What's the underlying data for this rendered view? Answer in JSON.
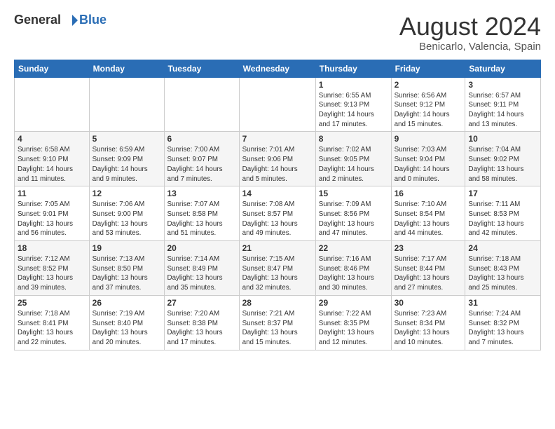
{
  "header": {
    "logo_general": "General",
    "logo_blue": "Blue",
    "title": "August 2024",
    "subtitle": "Benicarlo, Valencia, Spain"
  },
  "weekdays": [
    "Sunday",
    "Monday",
    "Tuesday",
    "Wednesday",
    "Thursday",
    "Friday",
    "Saturday"
  ],
  "weeks": [
    [
      {
        "day": "",
        "info": ""
      },
      {
        "day": "",
        "info": ""
      },
      {
        "day": "",
        "info": ""
      },
      {
        "day": "",
        "info": ""
      },
      {
        "day": "1",
        "info": "Sunrise: 6:55 AM\nSunset: 9:13 PM\nDaylight: 14 hours\nand 17 minutes."
      },
      {
        "day": "2",
        "info": "Sunrise: 6:56 AM\nSunset: 9:12 PM\nDaylight: 14 hours\nand 15 minutes."
      },
      {
        "day": "3",
        "info": "Sunrise: 6:57 AM\nSunset: 9:11 PM\nDaylight: 14 hours\nand 13 minutes."
      }
    ],
    [
      {
        "day": "4",
        "info": "Sunrise: 6:58 AM\nSunset: 9:10 PM\nDaylight: 14 hours\nand 11 minutes."
      },
      {
        "day": "5",
        "info": "Sunrise: 6:59 AM\nSunset: 9:09 PM\nDaylight: 14 hours\nand 9 minutes."
      },
      {
        "day": "6",
        "info": "Sunrise: 7:00 AM\nSunset: 9:07 PM\nDaylight: 14 hours\nand 7 minutes."
      },
      {
        "day": "7",
        "info": "Sunrise: 7:01 AM\nSunset: 9:06 PM\nDaylight: 14 hours\nand 5 minutes."
      },
      {
        "day": "8",
        "info": "Sunrise: 7:02 AM\nSunset: 9:05 PM\nDaylight: 14 hours\nand 2 minutes."
      },
      {
        "day": "9",
        "info": "Sunrise: 7:03 AM\nSunset: 9:04 PM\nDaylight: 14 hours\nand 0 minutes."
      },
      {
        "day": "10",
        "info": "Sunrise: 7:04 AM\nSunset: 9:02 PM\nDaylight: 13 hours\nand 58 minutes."
      }
    ],
    [
      {
        "day": "11",
        "info": "Sunrise: 7:05 AM\nSunset: 9:01 PM\nDaylight: 13 hours\nand 56 minutes."
      },
      {
        "day": "12",
        "info": "Sunrise: 7:06 AM\nSunset: 9:00 PM\nDaylight: 13 hours\nand 53 minutes."
      },
      {
        "day": "13",
        "info": "Sunrise: 7:07 AM\nSunset: 8:58 PM\nDaylight: 13 hours\nand 51 minutes."
      },
      {
        "day": "14",
        "info": "Sunrise: 7:08 AM\nSunset: 8:57 PM\nDaylight: 13 hours\nand 49 minutes."
      },
      {
        "day": "15",
        "info": "Sunrise: 7:09 AM\nSunset: 8:56 PM\nDaylight: 13 hours\nand 47 minutes."
      },
      {
        "day": "16",
        "info": "Sunrise: 7:10 AM\nSunset: 8:54 PM\nDaylight: 13 hours\nand 44 minutes."
      },
      {
        "day": "17",
        "info": "Sunrise: 7:11 AM\nSunset: 8:53 PM\nDaylight: 13 hours\nand 42 minutes."
      }
    ],
    [
      {
        "day": "18",
        "info": "Sunrise: 7:12 AM\nSunset: 8:52 PM\nDaylight: 13 hours\nand 39 minutes."
      },
      {
        "day": "19",
        "info": "Sunrise: 7:13 AM\nSunset: 8:50 PM\nDaylight: 13 hours\nand 37 minutes."
      },
      {
        "day": "20",
        "info": "Sunrise: 7:14 AM\nSunset: 8:49 PM\nDaylight: 13 hours\nand 35 minutes."
      },
      {
        "day": "21",
        "info": "Sunrise: 7:15 AM\nSunset: 8:47 PM\nDaylight: 13 hours\nand 32 minutes."
      },
      {
        "day": "22",
        "info": "Sunrise: 7:16 AM\nSunset: 8:46 PM\nDaylight: 13 hours\nand 30 minutes."
      },
      {
        "day": "23",
        "info": "Sunrise: 7:17 AM\nSunset: 8:44 PM\nDaylight: 13 hours\nand 27 minutes."
      },
      {
        "day": "24",
        "info": "Sunrise: 7:18 AM\nSunset: 8:43 PM\nDaylight: 13 hours\nand 25 minutes."
      }
    ],
    [
      {
        "day": "25",
        "info": "Sunrise: 7:18 AM\nSunset: 8:41 PM\nDaylight: 13 hours\nand 22 minutes."
      },
      {
        "day": "26",
        "info": "Sunrise: 7:19 AM\nSunset: 8:40 PM\nDaylight: 13 hours\nand 20 minutes."
      },
      {
        "day": "27",
        "info": "Sunrise: 7:20 AM\nSunset: 8:38 PM\nDaylight: 13 hours\nand 17 minutes."
      },
      {
        "day": "28",
        "info": "Sunrise: 7:21 AM\nSunset: 8:37 PM\nDaylight: 13 hours\nand 15 minutes."
      },
      {
        "day": "29",
        "info": "Sunrise: 7:22 AM\nSunset: 8:35 PM\nDaylight: 13 hours\nand 12 minutes."
      },
      {
        "day": "30",
        "info": "Sunrise: 7:23 AM\nSunset: 8:34 PM\nDaylight: 13 hours\nand 10 minutes."
      },
      {
        "day": "31",
        "info": "Sunrise: 7:24 AM\nSunset: 8:32 PM\nDaylight: 13 hours\nand 7 minutes."
      }
    ]
  ]
}
